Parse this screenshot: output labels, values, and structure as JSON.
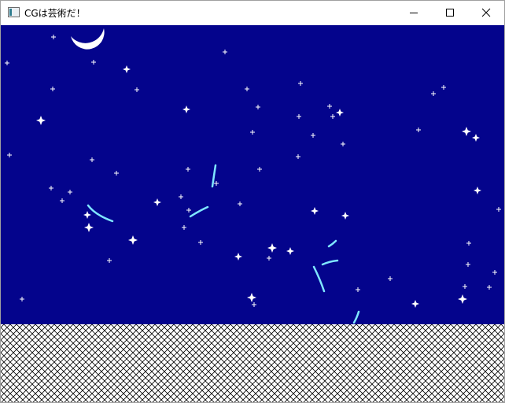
{
  "window": {
    "title": "CGは芸術だ！",
    "icon": "app-window-icon",
    "controls": [
      "minimize-icon",
      "maximize-icon",
      "close-icon"
    ]
  },
  "scene": {
    "sky_color": "#04048c",
    "ground_pattern": "crosshatch",
    "ground_line_color": "#000000",
    "ground_bg_color": "#ffffff",
    "star_color": "#ffffff",
    "meteor_color": "#7fe6ff",
    "moon_color": "#ffffff",
    "moon_shape": "crescent"
  }
}
